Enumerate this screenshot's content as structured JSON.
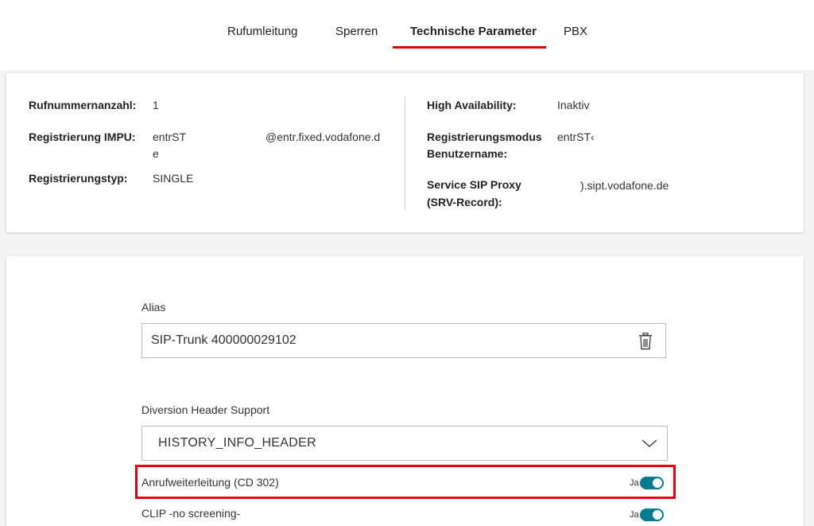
{
  "tabs": [
    {
      "label": "Rufumleitung"
    },
    {
      "label": "Sperren"
    },
    {
      "label": "Technische Parameter"
    },
    {
      "label": "PBX"
    }
  ],
  "info": {
    "rufnummernanzahl": {
      "label": "Rufnummernanzahl:",
      "value": "1"
    },
    "impu": {
      "label": "Registrierung IMPU:",
      "value_part1": "entrST",
      "value_part2": "e",
      "value_domain": "@entr.fixed.vodafone.d"
    },
    "typ": {
      "label": "Registrierungstyp:",
      "value": "SINGLE"
    },
    "high_availability": {
      "label": "High Availability:",
      "value": "Inaktiv"
    },
    "modus": {
      "label_line1": "Registrierungsmodus",
      "label_line2": "Benutzername:",
      "value": "entrST‹"
    },
    "proxy": {
      "label_line1": "Service SIP Proxy",
      "label_line2": "(SRV-Record):",
      "value": ").sipt.vodafone.de"
    }
  },
  "form": {
    "alias": {
      "label": "Alias",
      "value": "SIP-Trunk 400000029102"
    },
    "diversion": {
      "label": "Diversion Header Support",
      "value": "HISTORY_INFO_HEADER"
    },
    "rows": [
      {
        "label": "Anrufweiterleitung (CD 302)",
        "toggle_text": "Ja",
        "on": true
      },
      {
        "label": "CLIP -no screening-",
        "toggle_text": "Ja",
        "on": true
      }
    ]
  },
  "colors": {
    "accent": "#e60000",
    "toggle": "#007c92"
  }
}
